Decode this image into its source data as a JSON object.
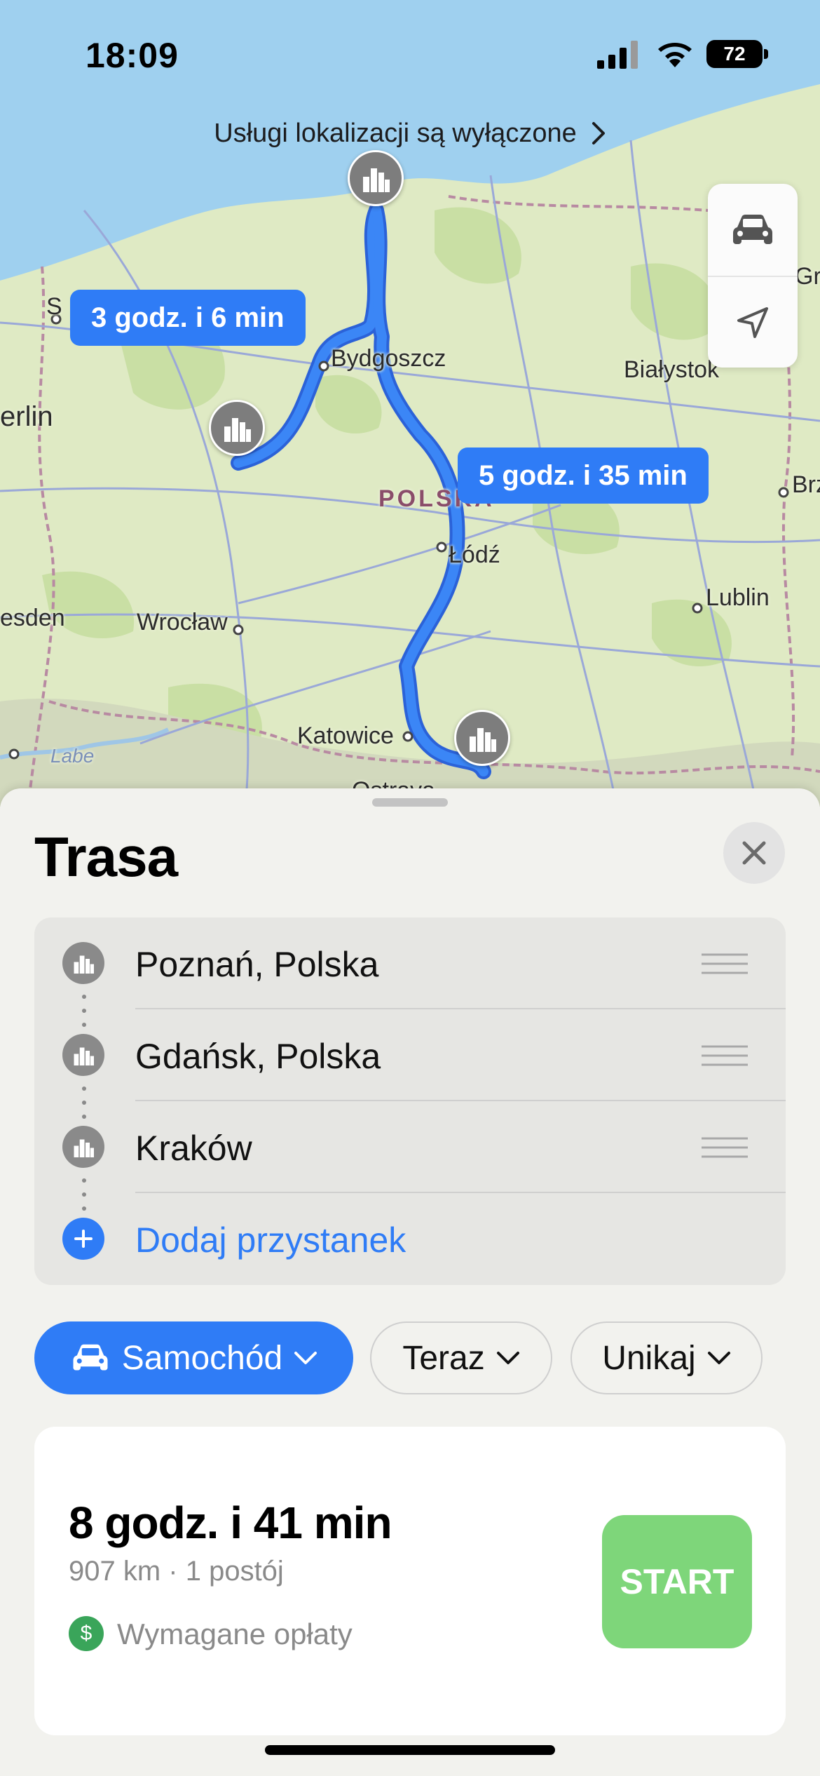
{
  "status_bar": {
    "time": "18:09",
    "battery": "72"
  },
  "banner": {
    "text": "Usługi lokalizacji są wyłączone",
    "chevron_icon": "chevron-right-icon"
  },
  "map": {
    "labels": {
      "bydgoszcz": "Bydgoszcz",
      "bialystok": "Białystok",
      "berlin": "erlin",
      "polska": "POLSKA",
      "lodz": "Łódź",
      "lublin": "Lublin",
      "dresden": "esden",
      "wroclaw": "Wrocław",
      "katowice": "Katowice",
      "ostrava": "Ostrava",
      "labe": "Labe",
      "gro": "Gro",
      "brz": "Brz",
      "s": "S"
    },
    "callouts": {
      "route_a": "3 godz. i 6 min",
      "route_b": "5 godz. i 35 min"
    },
    "controls": [
      "car-icon",
      "location-arrow-icon"
    ]
  },
  "sheet": {
    "title": "Trasa",
    "stops": [
      {
        "label": "Poznań, Polska"
      },
      {
        "label": "Gdańsk, Polska"
      },
      {
        "label": "Kraków"
      }
    ],
    "add_stop": "Dodaj przystanek",
    "chips": {
      "mode": "Samochód",
      "time": "Teraz",
      "avoid": "Unikaj"
    },
    "route": {
      "duration": "8 godz. i 41 min",
      "summary": "907 km · 1 postój",
      "fee": "Wymagane opłaty",
      "start": "START"
    }
  },
  "colors": {
    "accent": "#2f7cf6",
    "start": "#7ed67a",
    "fee": "#3aa55a"
  }
}
